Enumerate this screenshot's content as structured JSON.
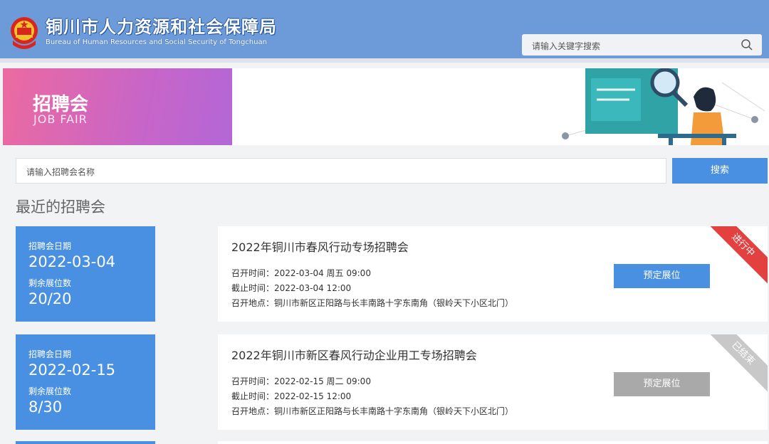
{
  "header": {
    "title": "铜川市人力资源和社会保障局",
    "subtitle": "Bureau of Human Resources and Social Security of Tongchuan",
    "search_placeholder": "请输入关键字搜索",
    "emblem_icon": "national-emblem-icon",
    "search_icon": "search-icon"
  },
  "banner": {
    "title": "招聘会",
    "subtitle": "JOB FAIR"
  },
  "fair_search": {
    "placeholder": "请输入招聘会名称",
    "button": "搜索"
  },
  "section_title": "最近的招聘会",
  "fairs": [
    {
      "date_label": "招聘会日期",
      "date": "2022-03-04",
      "slots_label": "剩余展位数",
      "slots": "20/20",
      "name": "2022年铜川市春风行动专场招聘会",
      "open_time": "召开时间：2022-03-04 周五  09:00",
      "close_time": "截止时间：2022-03-04 12:00",
      "location": "召开地点：铜川市新区正阳路与长丰南路十字东南角（银岭天下小区北门）",
      "button": "预定展位",
      "status": "进行中",
      "status_color": "#e2413f"
    },
    {
      "date_label": "招聘会日期",
      "date": "2022-02-15",
      "slots_label": "剩余展位数",
      "slots": "8/30",
      "name": "2022年铜川市新区春风行动企业用工专场招聘会",
      "open_time": "召开时间：2022-02-15 周二  09:00",
      "close_time": "截止时间：2022-02-15 12:00",
      "location": "召开地点：铜川市新区正阳路与长丰南路十字东南角（银岭天下小区北门）",
      "button": "预定展位",
      "status": "已结束",
      "status_color": "#c8c8c8"
    }
  ],
  "colors": {
    "header_bg": "#6d9ad8",
    "accent": "#4a90e2",
    "disabled": "#a9a9a9"
  }
}
